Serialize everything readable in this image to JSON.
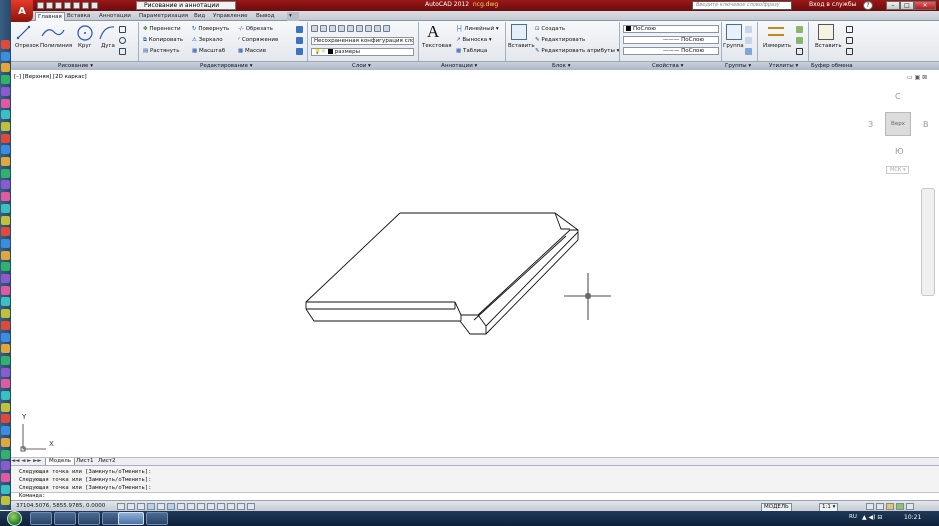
{
  "titlebar": {
    "workspace": "Рисование и аннотации",
    "app_name": "AutoCAD 2012",
    "file_name": "ncg.dwg",
    "search_placeholder": "Введите ключевое слово/фразу",
    "login": "Вход в службы",
    "help": "?"
  },
  "tabs": [
    "Главная",
    "Вставка",
    "Аннотации",
    "Параметризация",
    "Вид",
    "Управление",
    "Вывод"
  ],
  "ribbon": {
    "draw": {
      "line": "Отрезок",
      "polyline": "Полилиния",
      "circle": "Круг",
      "arc": "Дуга"
    },
    "modify": {
      "move": "Перенести",
      "rotate": "Повернуть",
      "trim": "Обрезать",
      "copy": "Копировать",
      "mirror": "Зеркало",
      "fillet": "Сопряжение",
      "stretch": "Растянуть",
      "scale": "Масштаб",
      "array": "Массив"
    },
    "layers": {
      "config": "Несохраненная конфигурация сло",
      "layer_name": "размеры"
    },
    "annotation": {
      "text": "Текстовая",
      "linear": "Линейный",
      "leader": "Выноска",
      "table": "Таблица"
    },
    "block": {
      "insert": "Вставить",
      "create": "Создать",
      "edit": "Редактировать",
      "edit_attr": "Редактировать атрибуты"
    },
    "properties": {
      "color": "ПоСлою",
      "linetype": "ПоСлою",
      "lineweight": "ПоСлою"
    },
    "groups": {
      "group": "Группа"
    },
    "utilities": {
      "measure": "Измерить"
    },
    "clipboard": {
      "paste": "Вставить"
    }
  },
  "panels": [
    "Рисование",
    "Редактирование",
    "Слои",
    "Аннотации",
    "Блок",
    "Свойства",
    "Группы",
    "Утилиты",
    "Буфер обмена"
  ],
  "viewport": {
    "label": "[–] [Верхняя] [2D каркас]"
  },
  "viewcube": {
    "north": "С",
    "south": "Ю",
    "west": "З",
    "east": "В",
    "face": "Верх",
    "wcs": "МСК"
  },
  "ucs": {
    "x": "X",
    "y": "Y"
  },
  "layout_tabs": [
    "Модель",
    "Лист1",
    "Лист2"
  ],
  "command": {
    "history": [
      "Следующая точка или [Замкнуть/оТменить]:",
      "Следующая точка или [Замкнуть/оТменить]:",
      "Следующая точка или [Замкнуть/оТменить]:"
    ],
    "prompt": "Команда:"
  },
  "status": {
    "coords": "37104.5076, 5855.9785, 0.0000",
    "model": "МОДЕЛЬ",
    "scale": "1:1"
  },
  "taskbar": {
    "lang": "RU",
    "time": "10:21"
  },
  "colors": {
    "title_bg": "#8c1313",
    "ribbon_bg": "#e8ebef",
    "panelbar": "#b9c2cf",
    "taskbar": "#132a45"
  }
}
